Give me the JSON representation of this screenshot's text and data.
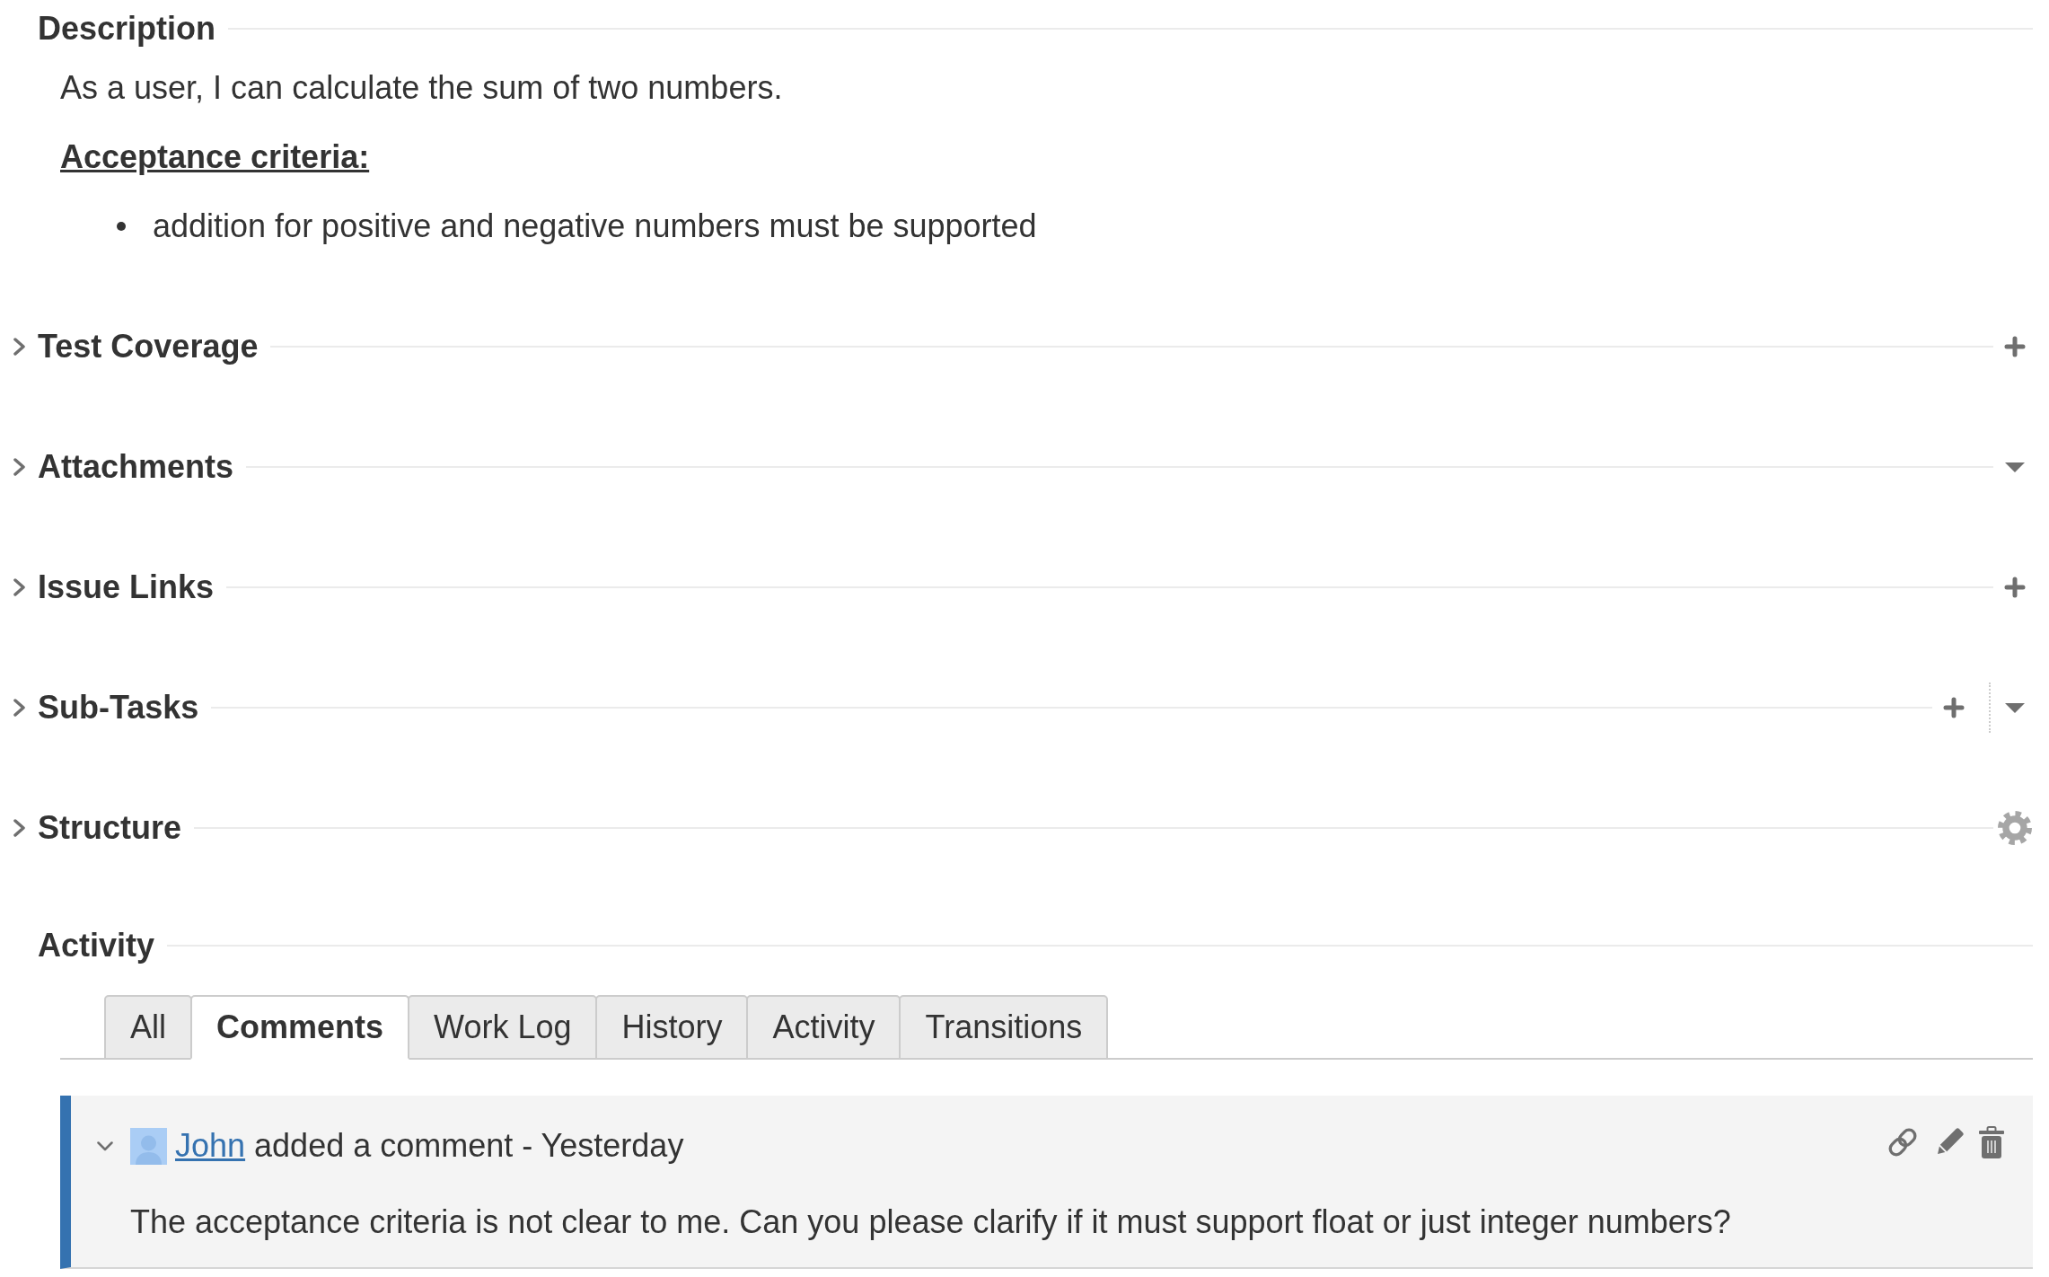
{
  "description": {
    "title": "Description",
    "text": "As a user, I can calculate the sum of two numbers.",
    "criteria_title": "Acceptance criteria:",
    "criteria": [
      "addition for positive and negative numbers must be supported"
    ]
  },
  "sections": [
    {
      "title": "Test Coverage",
      "expanded": false,
      "actions": [
        {
          "kind": "add"
        }
      ]
    },
    {
      "title": "Attachments",
      "expanded": false,
      "actions": [
        {
          "kind": "menu"
        }
      ]
    },
    {
      "title": "Issue Links",
      "expanded": false,
      "actions": [
        {
          "kind": "add"
        }
      ]
    },
    {
      "title": "Sub-Tasks",
      "expanded": false,
      "actions": [
        {
          "kind": "add"
        },
        {
          "kind": "menu"
        }
      ]
    },
    {
      "title": "Structure",
      "expanded": false,
      "actions": [
        {
          "kind": "settings"
        }
      ]
    }
  ],
  "activity": {
    "title": "Activity",
    "tabs": [
      {
        "label": "All",
        "selected": false
      },
      {
        "label": "Comments",
        "selected": true
      },
      {
        "label": "Work Log",
        "selected": false
      },
      {
        "label": "History",
        "selected": false
      },
      {
        "label": "Activity",
        "selected": false
      },
      {
        "label": "Transitions",
        "selected": false
      }
    ],
    "comments": [
      {
        "expanded": true,
        "author": "John",
        "action": "added a comment - Yesterday",
        "body": "The acceptance criteria is not clear to me. Can you please clarify if it must support float or just integer numbers?",
        "actions": [
          {
            "kind": "permalink"
          },
          {
            "kind": "edit"
          },
          {
            "kind": "delete"
          }
        ]
      }
    ]
  }
}
